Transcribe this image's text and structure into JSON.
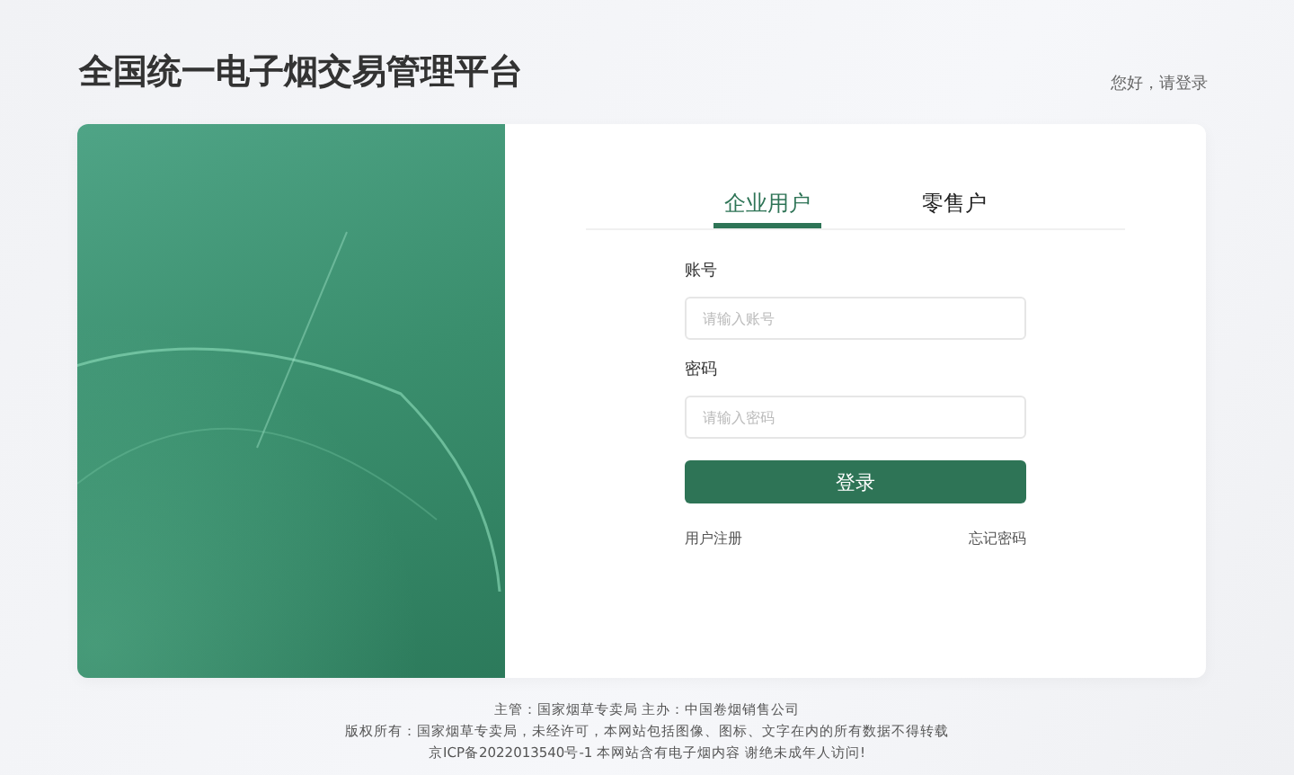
{
  "header": {
    "title": "全国统一电子烟交易管理平台",
    "greeting": "您好，请登录"
  },
  "tabs": [
    {
      "label": "企业用户",
      "selected": true
    },
    {
      "label": "零售户",
      "selected": false
    }
  ],
  "form": {
    "fields": [
      {
        "label": "账号",
        "placeholder": "请输入账号"
      },
      {
        "label": "密码",
        "placeholder": "请输入密码"
      }
    ],
    "submit": "登录",
    "register_link": "用户注册",
    "forgot_link": "忘记密码"
  },
  "footer": [
    "主管：国家烟草专卖局 主办：中国卷烟销售公司",
    "版权所有：国家烟草专卖局，未经许可，本网站包括图像、图标、文字在内的所有数据不得转载",
    "京ICP备2022013540号-1 本网站含有电子烟内容 谢绝未成年人访问!"
  ]
}
